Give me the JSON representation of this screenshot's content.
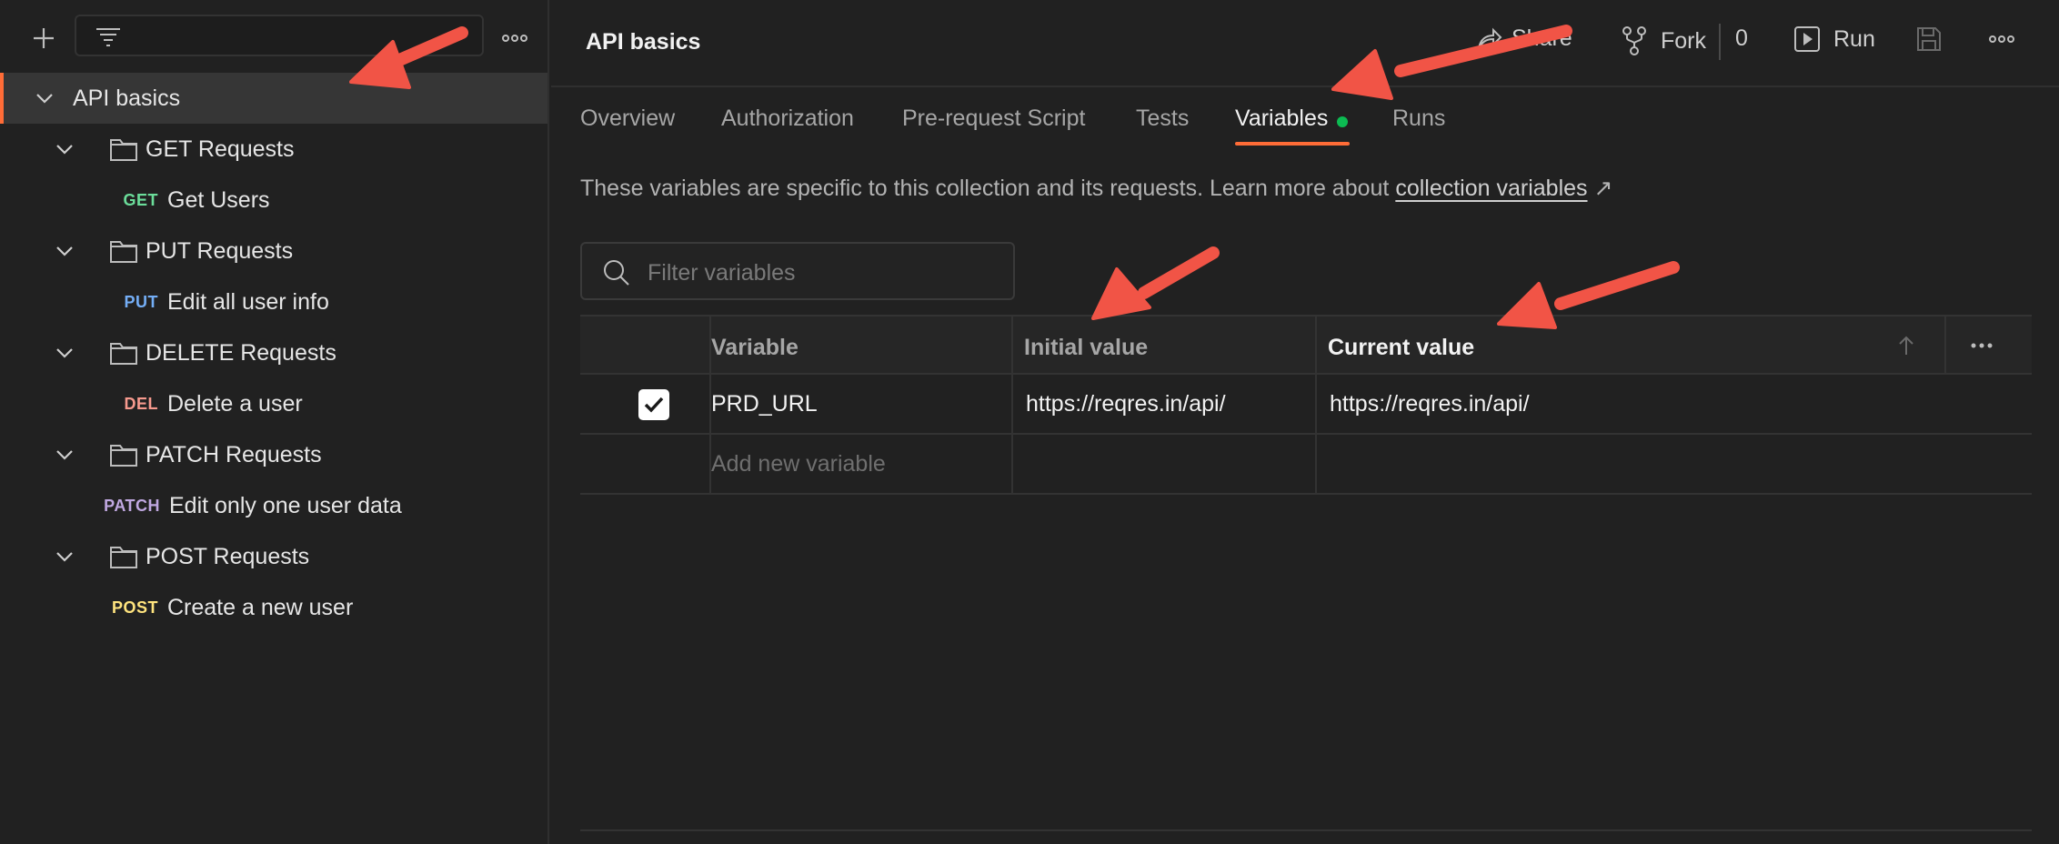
{
  "sidebar": {
    "collection": {
      "name": "API basics"
    },
    "tree": [
      {
        "type": "folder",
        "label": "GET Requests"
      },
      {
        "type": "request",
        "method": "GET",
        "method_color": "#6bdd9a",
        "label": "Get Users"
      },
      {
        "type": "folder",
        "label": "PUT Requests"
      },
      {
        "type": "request",
        "method": "PUT",
        "method_color": "#74aef6",
        "label": "Edit all user info"
      },
      {
        "type": "folder",
        "label": "DELETE Requests"
      },
      {
        "type": "request",
        "method": "DEL",
        "method_color": "#f79a8e",
        "label": "Delete a user"
      },
      {
        "type": "folder",
        "label": "PATCH Requests"
      },
      {
        "type": "request",
        "method": "PATCH",
        "method_color": "#c0a8e1",
        "label": "Edit only one user data"
      },
      {
        "type": "folder",
        "label": "POST Requests"
      },
      {
        "type": "request",
        "method": "POST",
        "method_color": "#ffe47e",
        "label": "Create a new user"
      }
    ]
  },
  "header": {
    "title": "API basics",
    "share_label": "Share",
    "fork_label": "Fork",
    "fork_count": "0",
    "run_label": "Run"
  },
  "tabs": [
    {
      "label": "Overview"
    },
    {
      "label": "Authorization"
    },
    {
      "label": "Pre-request Script"
    },
    {
      "label": "Tests"
    },
    {
      "label": "Variables",
      "active": true
    },
    {
      "label": "Runs"
    }
  ],
  "variables": {
    "description": "These variables are specific to this collection and its requests. Learn more about ",
    "link_text": "collection variables",
    "link_suffix": " ↗",
    "filter_placeholder": "Filter variables",
    "columns": {
      "variable": "Variable",
      "initial": "Initial value",
      "current": "Current value"
    },
    "rows": [
      {
        "checked": true,
        "variable": "PRD_URL",
        "initial": "https://reqres.in/api/",
        "current": "https://reqres.in/api/"
      }
    ],
    "add_placeholder": "Add new variable"
  },
  "colors": {
    "accent": "#ff6c37",
    "active_dot": "#0cbb52",
    "annotation_arrow": "#f15446"
  }
}
